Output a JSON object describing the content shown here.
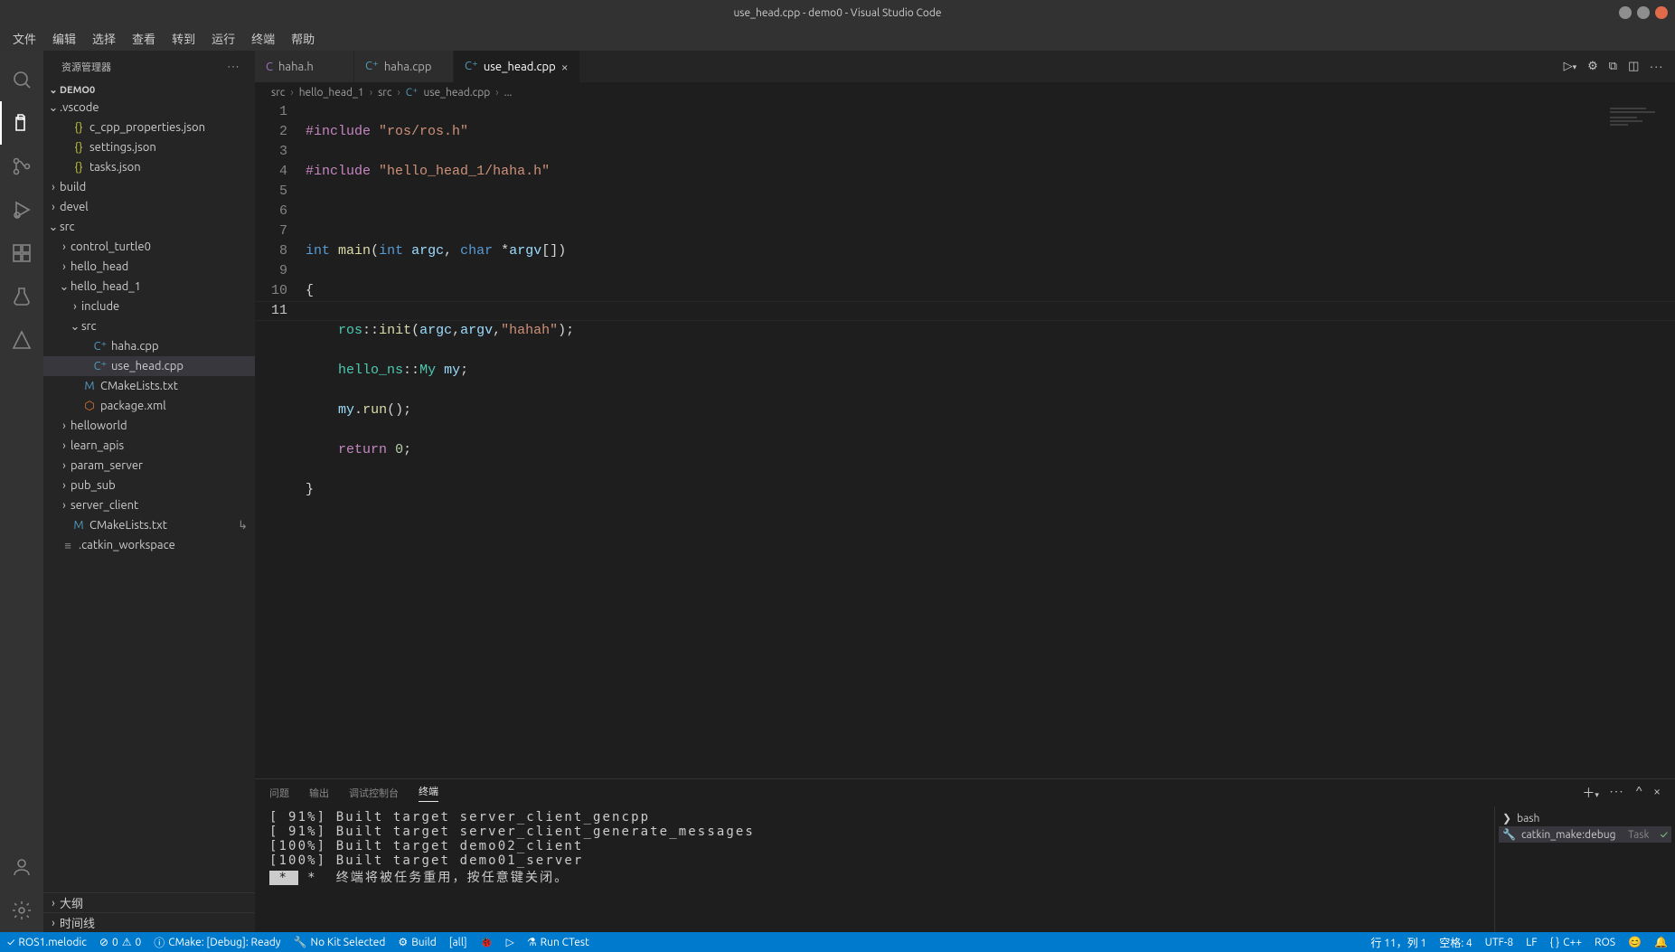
{
  "window": {
    "title": "use_head.cpp - demo0 - Visual Studio Code"
  },
  "menu": [
    "文件",
    "编辑",
    "选择",
    "查看",
    "转到",
    "运行",
    "终端",
    "帮助"
  ],
  "sidebar": {
    "title": "资源管理器",
    "project": "DEMO0",
    "outline": "大纲",
    "timeline": "时间线"
  },
  "tree": {
    "vscode_folder": ".vscode",
    "c_cpp_properties": "c_cpp_properties.json",
    "settings_json": "settings.json",
    "tasks_json": "tasks.json",
    "build": "build",
    "devel": "devel",
    "src": "src",
    "control_turtle0": "control_turtle0",
    "hello_head": "hello_head",
    "hello_head_1": "hello_head_1",
    "include": "include",
    "src2": "src",
    "haha_cpp": "haha.cpp",
    "use_head_cpp": "use_head.cpp",
    "CMakeLists_txt": "CMakeLists.txt",
    "package_xml": "package.xml",
    "helloworld": "helloworld",
    "learn_apis": "learn_apis",
    "param_server": "param_server",
    "pub_sub": "pub_sub",
    "server_client": "server_client",
    "CMakeLists_txt2": "CMakeLists.txt",
    "catkin_workspace": ".catkin_workspace"
  },
  "tabs": {
    "haha_h": "haha.h",
    "haha_cpp": "haha.cpp",
    "use_head_cpp": "use_head.cpp"
  },
  "breadcrumb": {
    "p1": "src",
    "p2": "hello_head_1",
    "p3": "src",
    "p4": "use_head.cpp",
    "p5": "..."
  },
  "code": {
    "lines": [
      "1",
      "2",
      "3",
      "4",
      "5",
      "6",
      "7",
      "8",
      "9",
      "10",
      "11"
    ],
    "l1_directive": "#include",
    "l1_string": "\"ros/ros.h\"",
    "l2_directive": "#include",
    "l2_string": "\"hello_head_1/haha.h\"",
    "l4_int": "int",
    "l4_main": "main",
    "l4_int2": "int",
    "l4_argc": "argc",
    "l4_char": "char",
    "l4_argv": "argv",
    "l5_brace": "{",
    "l6_ns": "ros",
    "l6_init": "init",
    "l6_argc": "argc",
    "l6_argv": "argv",
    "l6_str": "\"hahah\"",
    "l7_ns": "hello_ns",
    "l7_my_t": "My",
    "l7_my": "my",
    "l8_my": "my",
    "l8_run": "run",
    "l9_return": "return",
    "l9_zero": "0",
    "l10_brace": "}"
  },
  "panel": {
    "problems": "问题",
    "output": "输出",
    "debug_console": "调试控制台",
    "terminal": "终端",
    "out_line1": "[ 91%] Built target server_client_gencpp",
    "out_line2": "[ 91%] Built target server_client_generate_messages",
    "out_line3": "[100%] Built target demo02_client",
    "out_line4": "[100%] Built target demo01_server",
    "out_line5": " *  终端将被任务重用，按任意键关闭。",
    "term_bash": "bash",
    "term_catkin": "catkin_make:debug",
    "term_task": "Task"
  },
  "status": {
    "ros": "ROS1.melodic",
    "errors": "0",
    "warnings": "0",
    "cmake": "CMake: [Debug]: Ready",
    "nokit": "No Kit Selected",
    "build": "Build",
    "target": "[all]",
    "runctest": "Run CTest",
    "lncol": "行 11，列 1",
    "spaces": "空格: 4",
    "encoding": "UTF-8",
    "eol": "LF",
    "lang": "C++",
    "ros_right": "ROS"
  }
}
